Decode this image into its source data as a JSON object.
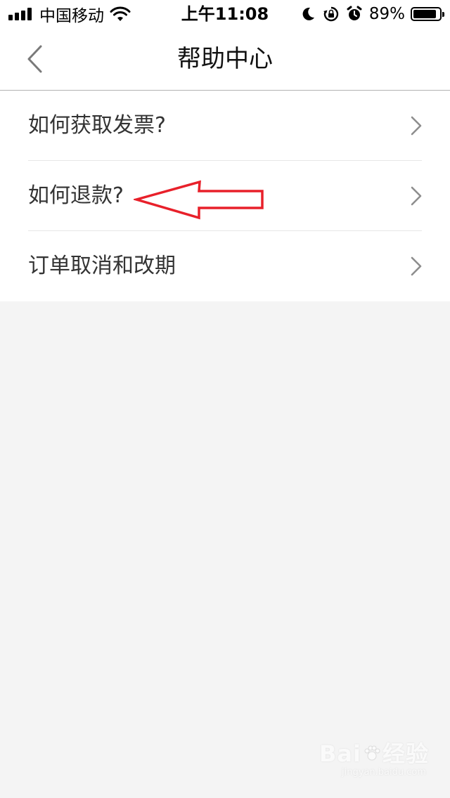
{
  "status_bar": {
    "carrier": "中国移动",
    "time": "上午11:08",
    "battery_percent": "89%",
    "battery_level": 0.89,
    "icons": [
      "signal-icon",
      "wifi-icon",
      "moon-icon",
      "orientation-lock-icon",
      "alarm-icon",
      "battery-icon"
    ]
  },
  "nav": {
    "back_icon": "chevron-left-icon",
    "title": "帮助中心"
  },
  "menu": {
    "items": [
      {
        "label": "如何获取发票?",
        "icon": "chevron-right-icon"
      },
      {
        "label": "如何退款?",
        "icon": "chevron-right-icon"
      },
      {
        "label": "订单取消和改期",
        "icon": "chevron-right-icon"
      }
    ]
  },
  "annotation": {
    "type": "arrow-icon",
    "color": "#e8202a",
    "points_to": "如何退款?"
  },
  "watermark": {
    "main": "Bai 经验",
    "sub": "jingyan.baidu.com"
  },
  "colors": {
    "background": "#f4f4f4",
    "surface": "#ffffff",
    "text": "#333333",
    "chevron": "#8e8e8e",
    "divider": "#e6e6e6",
    "nav_border": "#b2b2b2"
  }
}
